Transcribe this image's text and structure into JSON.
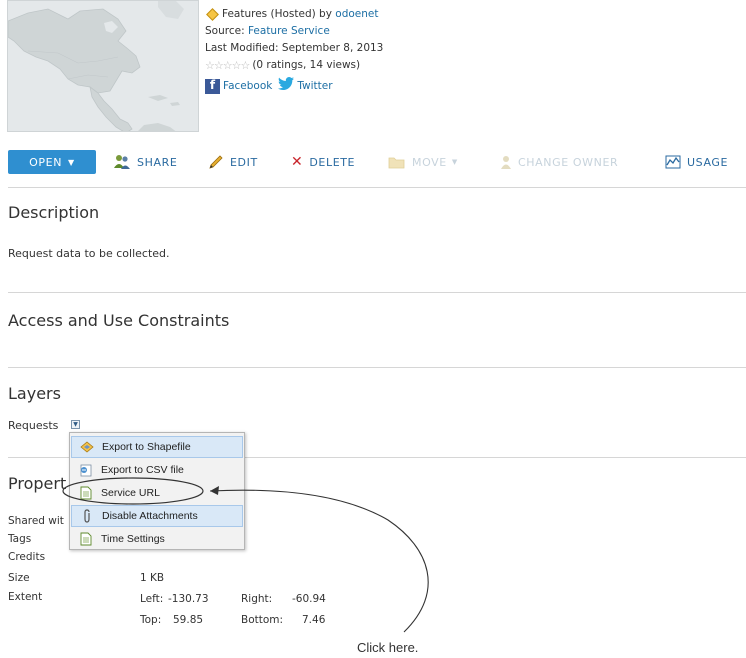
{
  "item": {
    "type_prefix": "Features (Hosted) by",
    "owner": "odoenet",
    "source_label": "Source:",
    "source_value": "Feature Service",
    "modified_label": "Last Modified:",
    "modified_value": "September 8, 2013",
    "stars_glyph": "☆☆☆☆☆",
    "ratings": "(0 ratings, 14 views)",
    "facebook": "Facebook",
    "twitter": "Twitter"
  },
  "toolbar": {
    "open": "OPEN",
    "share": "SHARE",
    "edit": "EDIT",
    "delete": "DELETE",
    "move": "MOVE",
    "change_owner": "CHANGE OWNER",
    "usage": "USAGE"
  },
  "description": {
    "heading": "Description",
    "text": "Request data to be collected."
  },
  "constraints": {
    "heading": "Access and Use Constraints"
  },
  "layers": {
    "heading": "Layers",
    "layer_name": "Requests"
  },
  "properties": {
    "heading": "Propert",
    "shared_label": "Shared wit",
    "tags_label": "Tags",
    "credits_label": "Credits",
    "size_label": "Size",
    "size_value": "1 KB",
    "extent_label": "Extent",
    "left_label": "Left:",
    "left_value": "-130.73",
    "right_label": "Right:",
    "right_value": "-60.94",
    "top_label": "Top:",
    "top_value": "59.85",
    "bottom_label": "Bottom:",
    "bottom_value": "7.46"
  },
  "layer_menu": {
    "items": [
      {
        "label": "Export to Shapefile",
        "icon": "shapefile-icon"
      },
      {
        "label": "Export to CSV file",
        "icon": "csv-icon"
      },
      {
        "label": "Service URL",
        "icon": "document-icon"
      },
      {
        "label": "Disable Attachments",
        "icon": "paperclip-icon"
      },
      {
        "label": "Time Settings",
        "icon": "document-icon"
      }
    ]
  },
  "annotation": {
    "text": "Click here."
  },
  "colors": {
    "accent": "#2f8fd0",
    "link": "#1c6ea4",
    "delete": "#c8242b"
  }
}
